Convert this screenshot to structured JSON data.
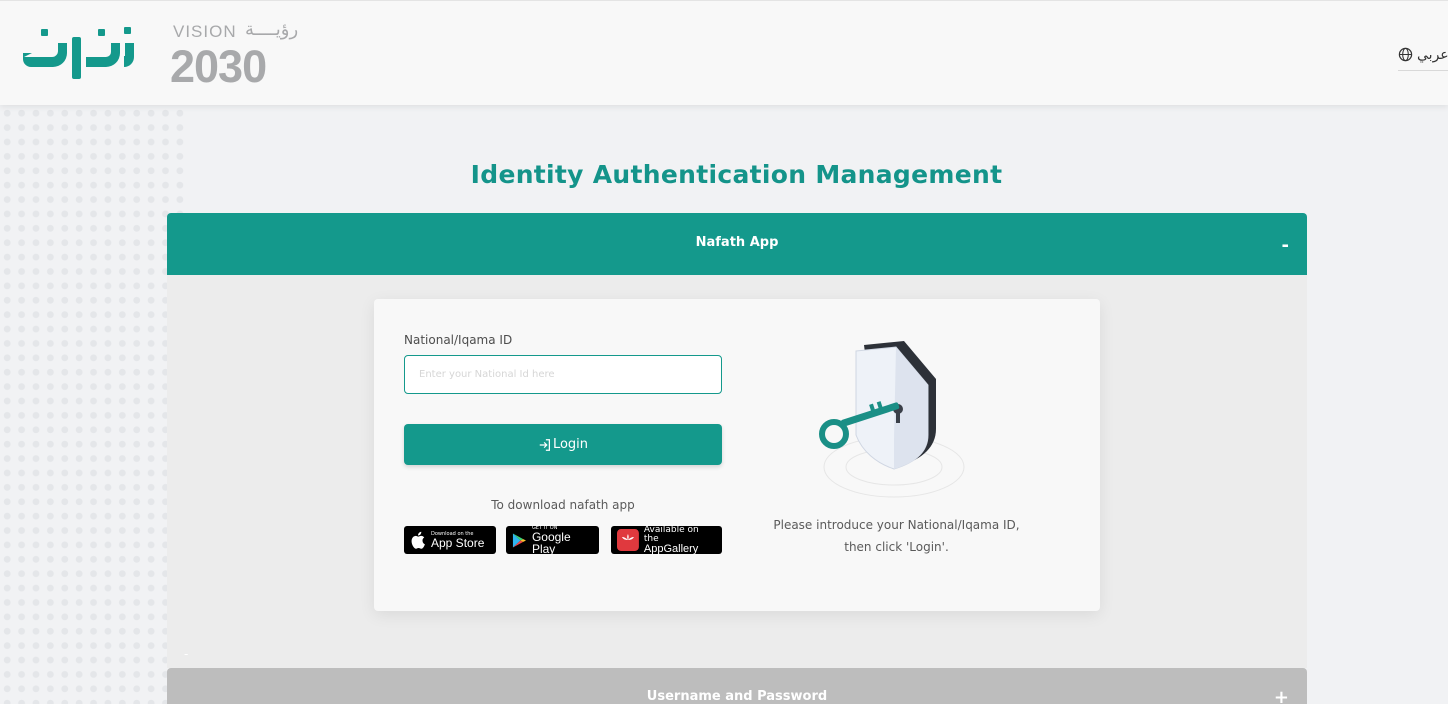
{
  "header": {
    "logo_text": "نفاذ",
    "vision": {
      "text": "VISION",
      "arabic": "رؤيــــة",
      "year": "2030"
    },
    "language_label": "عربي"
  },
  "page": {
    "title": "Identity Authentication Management"
  },
  "accordion": {
    "nafath": {
      "label": "Nafath App",
      "toggle": "-"
    },
    "username": {
      "label": "Username and Password",
      "toggle": "+"
    },
    "body_dash": "-"
  },
  "form": {
    "id_label": "National/Iqama ID",
    "id_placeholder": "Enter your National Id here",
    "login_label": "Login",
    "download_text": "To download nafath app"
  },
  "stores": {
    "apple": {
      "small": "Download on the",
      "big": "App Store"
    },
    "google": {
      "small": "GET IT ON",
      "big": "Google Play"
    },
    "huawei": {
      "small": "Available on the",
      "big": "AppGallery"
    }
  },
  "instructions": {
    "line1": "Please introduce your National/Iqama ID,",
    "line2": "then click 'Login'."
  },
  "colors": {
    "primary": "#14998c",
    "title": "#14948a",
    "secondary_header": "#bdbdbd",
    "background": "#f1f2f4"
  }
}
